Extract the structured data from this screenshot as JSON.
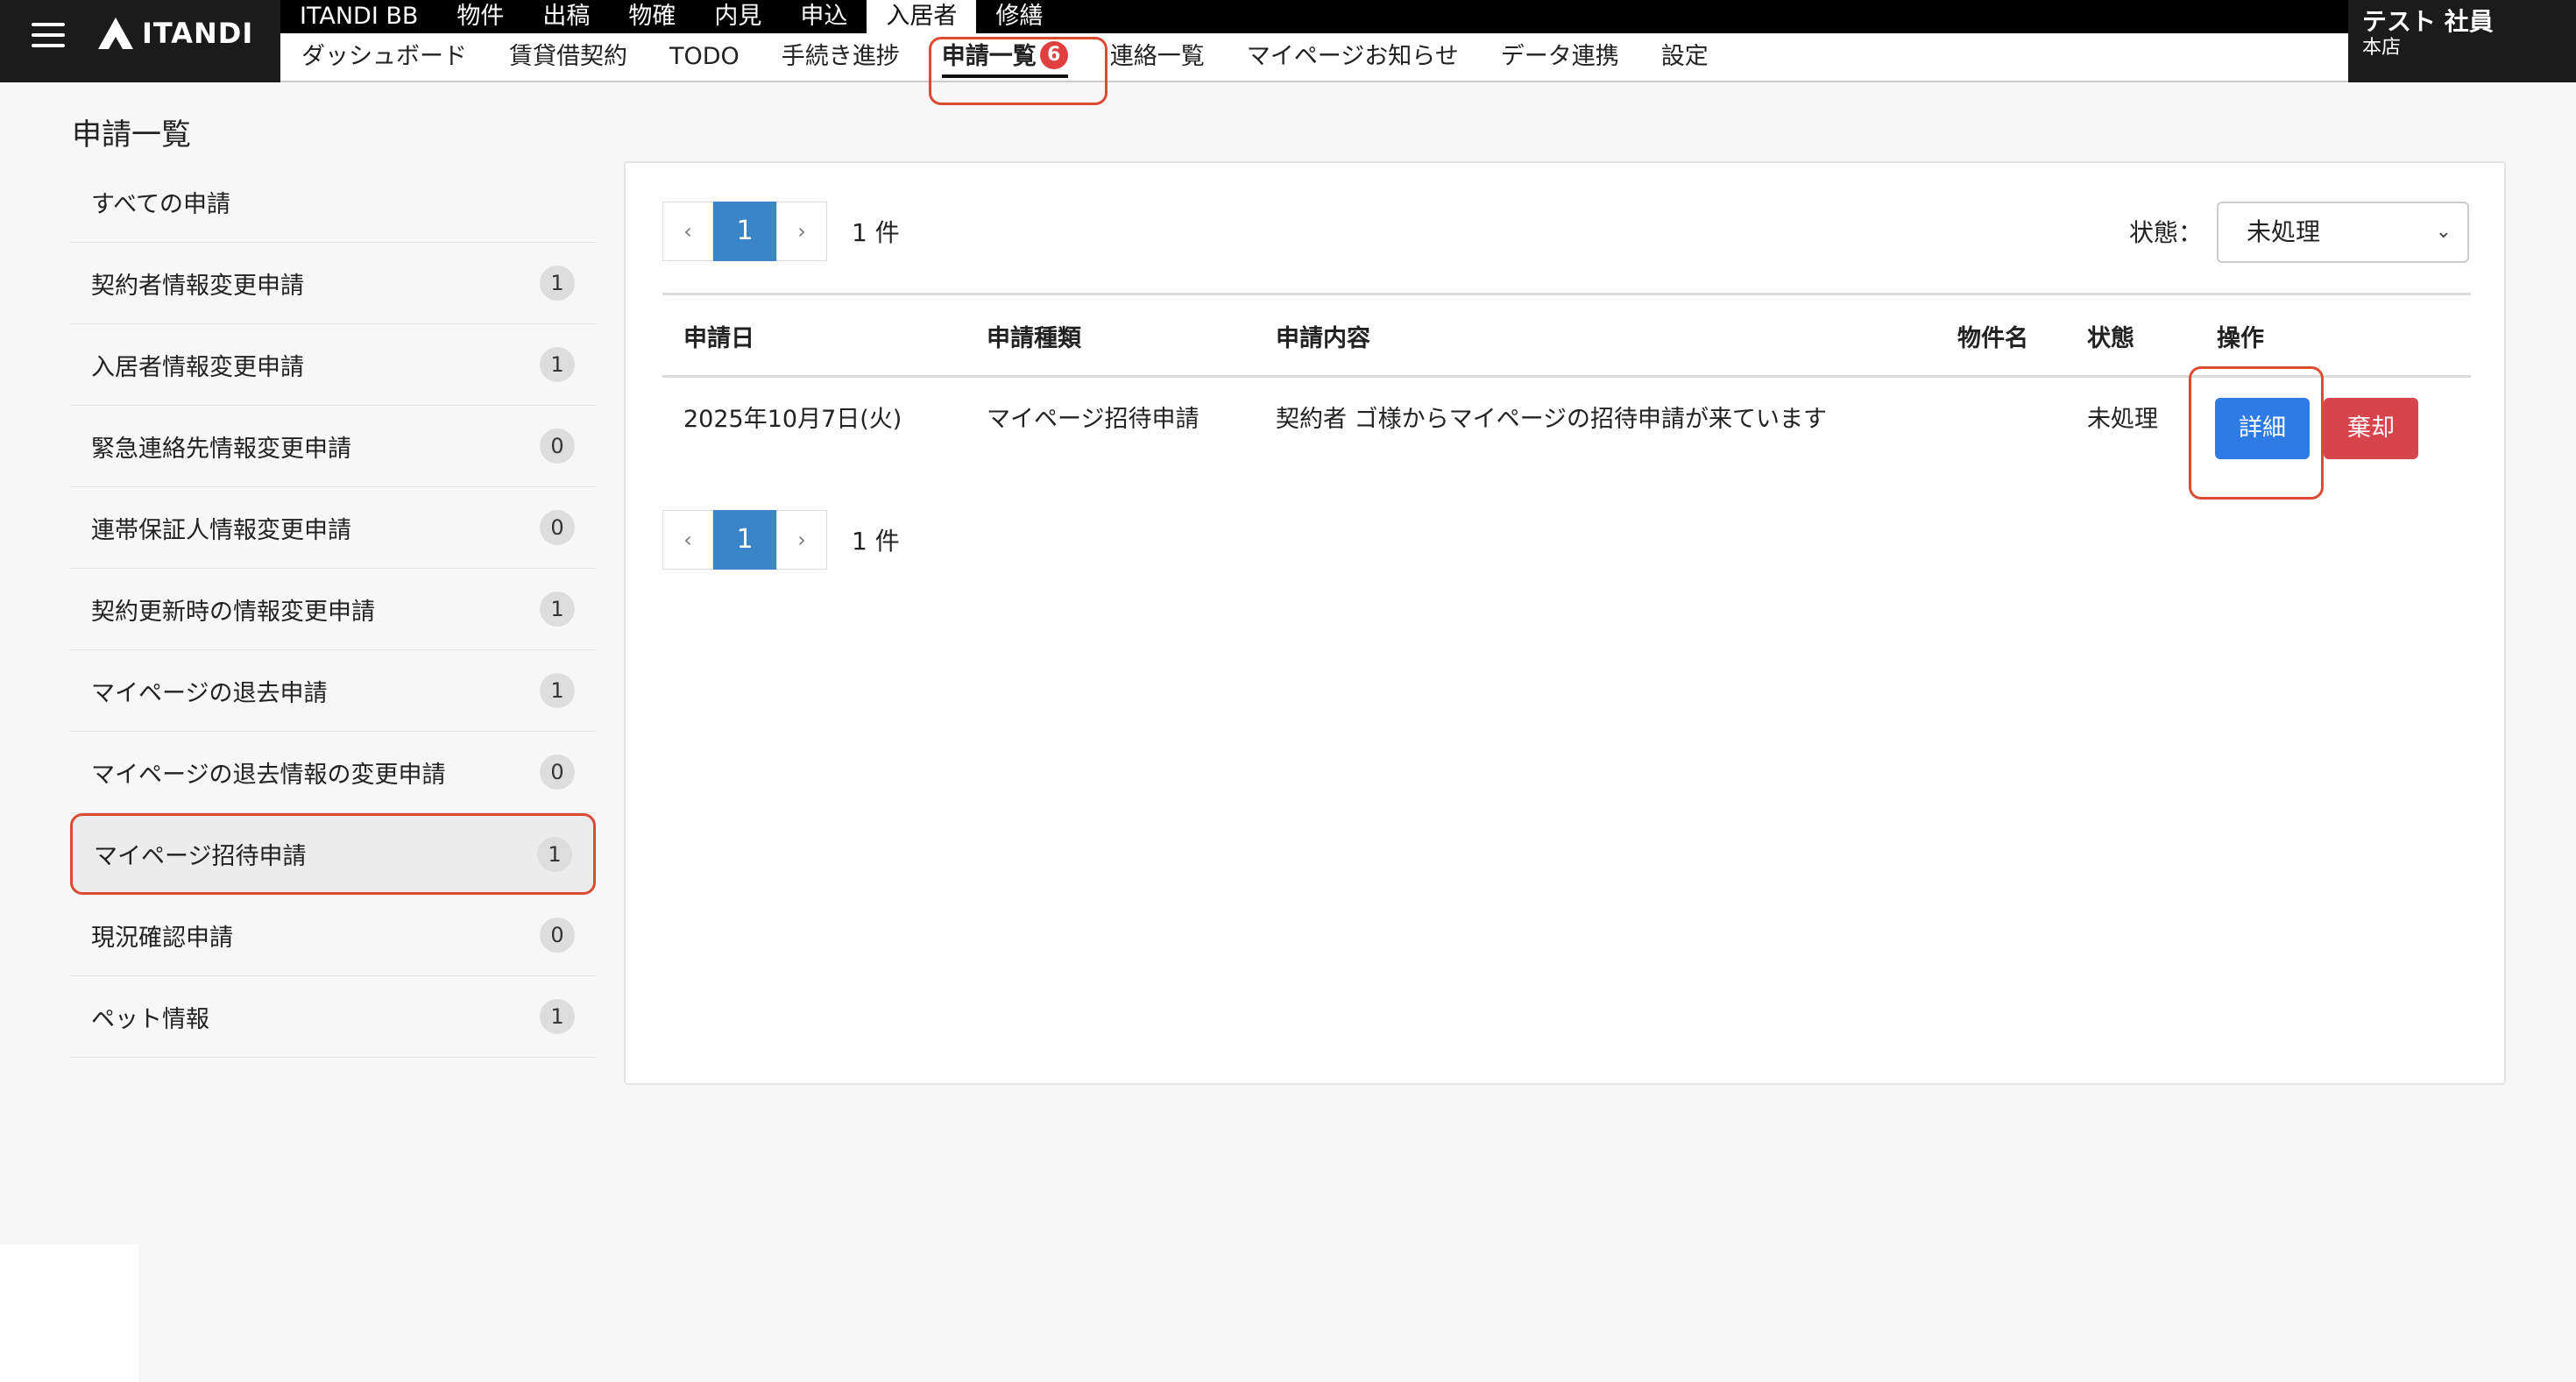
{
  "app": {
    "logo_text": "ITANDI",
    "user_name": "テスト 社員",
    "user_branch": "本店"
  },
  "main_nav": [
    {
      "label": "ITANDI BB",
      "active": false
    },
    {
      "label": "物件",
      "active": false
    },
    {
      "label": "出稿",
      "active": false
    },
    {
      "label": "物確",
      "active": false
    },
    {
      "label": "内見",
      "active": false
    },
    {
      "label": "申込",
      "active": false
    },
    {
      "label": "入居者",
      "active": true
    },
    {
      "label": "修繕",
      "active": false
    }
  ],
  "sub_nav": [
    {
      "label": "ダッシュボード"
    },
    {
      "label": "賃貸借契約"
    },
    {
      "label": "TODO"
    },
    {
      "label": "手続き進捗"
    },
    {
      "label": "申請一覧",
      "badge": "6",
      "active": true
    },
    {
      "label": "連絡一覧"
    },
    {
      "label": "マイページお知らせ"
    },
    {
      "label": "データ連携"
    },
    {
      "label": "設定"
    }
  ],
  "page": {
    "title": "申請一覧"
  },
  "sidebar": {
    "items": [
      {
        "label": "すべての申請",
        "count": ""
      },
      {
        "label": "契約者情報変更申請",
        "count": "1"
      },
      {
        "label": "入居者情報変更申請",
        "count": "1"
      },
      {
        "label": "緊急連絡先情報変更申請",
        "count": "0"
      },
      {
        "label": "連帯保証人情報変更申請",
        "count": "0"
      },
      {
        "label": "契約更新時の情報変更申請",
        "count": "1"
      },
      {
        "label": "マイページの退去申請",
        "count": "1"
      },
      {
        "label": "マイページの退去情報の変更申請",
        "count": "0"
      },
      {
        "label": "マイページ招待申請",
        "count": "1",
        "selected": true
      },
      {
        "label": "現況確認申請",
        "count": "0"
      },
      {
        "label": "ペット情報",
        "count": "1"
      }
    ]
  },
  "pagination": {
    "prev": "‹",
    "next": "›",
    "current_page": "1",
    "count_text": "1 件"
  },
  "filter": {
    "status_label": "状態：",
    "status_value": "未処理"
  },
  "table": {
    "headers": {
      "date": "申請日",
      "type": "申請種類",
      "content": "申請内容",
      "property": "物件名",
      "status": "状態",
      "actions": "操作"
    },
    "rows": [
      {
        "date": "2025年10月7日(火)",
        "type": "マイページ招待申請",
        "content": "契約者 ゴ様からマイページの招待申請が来ています",
        "property": "",
        "status": "未処理",
        "detail_label": "詳細",
        "discard_label": "棄却"
      }
    ]
  },
  "colors": {
    "accent_blue": "#3a84c8",
    "detail_button": "#2f7be6",
    "discard_button": "#d8444c",
    "highlight_red": "#dc4a32",
    "badge_red": "#e04040"
  }
}
